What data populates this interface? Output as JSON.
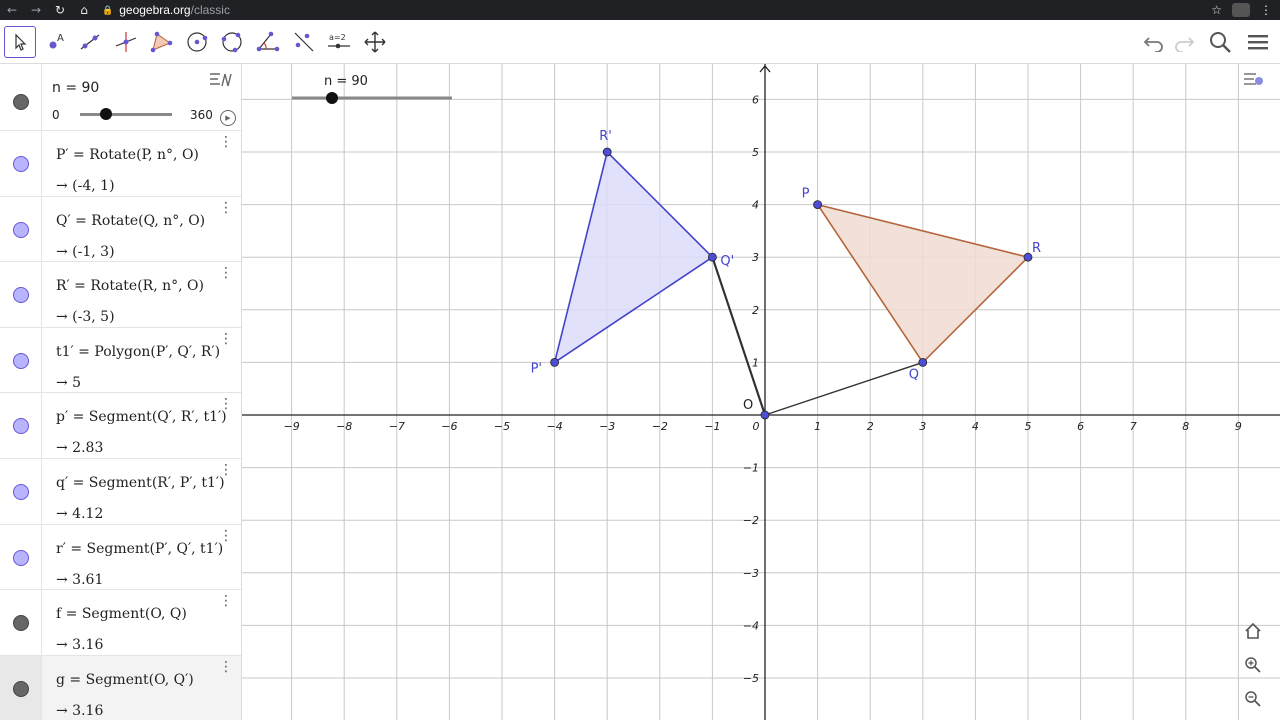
{
  "browser": {
    "back_icon": "arrow-left-icon",
    "forward_icon": "arrow-right-icon",
    "reload_icon": "reload-icon",
    "home_icon": "home-icon",
    "url_domain": "geogebra.org",
    "url_path": "/classic"
  },
  "toolbar": {
    "tools": [
      "move-tool",
      "point-tool",
      "line-tool",
      "perpendicular-line-tool",
      "polygon-tool",
      "circle-tool",
      "conic-tool",
      "angle-tool",
      "reflect-tool",
      "slider-tool",
      "move-graphics-tool"
    ],
    "slider_tool_label": "a=2",
    "right_icons": [
      "undo-icon",
      "redo-icon",
      "search-icon",
      "menu-icon"
    ]
  },
  "algebra": {
    "slider": {
      "name": "n = 90",
      "min": "0",
      "max": "360",
      "value": 90
    },
    "rows": [
      {
        "def": "P′ = Rotate(P, n°, O)",
        "val": "→  (-4, 1)",
        "color": "blue"
      },
      {
        "def": "Q′ = Rotate(Q, n°, O)",
        "val": "→  (-1, 3)",
        "color": "blue"
      },
      {
        "def": "R′ = Rotate(R, n°, O)",
        "val": "→  (-3, 5)",
        "color": "blue"
      },
      {
        "def": "t1′ = Polygon(P′, Q′, R′)",
        "val": "→  5",
        "color": "blue"
      },
      {
        "def": "p′ = Segment(Q′, R′, t1′)",
        "val": "→  2.83",
        "color": "blue"
      },
      {
        "def": "q′ = Segment(R′, P′, t1′)",
        "val": "→  4.12",
        "color": "blue"
      },
      {
        "def": "r′ = Segment(P′, Q′, t1′)",
        "val": "→  3.61",
        "color": "blue"
      },
      {
        "def": "f = Segment(O, Q)",
        "val": "→  3.16",
        "color": "dark"
      },
      {
        "def": "g = Segment(O, Q′)",
        "val": "→  3.16",
        "color": "dark"
      }
    ]
  },
  "graphics": {
    "slider_label": "n = 90",
    "x_ticks": [
      "−9",
      "−8",
      "−7",
      "−6",
      "−5",
      "−4",
      "−3",
      "−2",
      "−1",
      "0",
      "1",
      "2",
      "3",
      "4",
      "5",
      "6",
      "7",
      "8",
      "9"
    ],
    "y_ticks": [
      "6",
      "5",
      "4",
      "3",
      "2",
      "1",
      "−1",
      "−2",
      "−3",
      "−4",
      "−5"
    ],
    "points": [
      {
        "label": "P",
        "x": 1,
        "y": 4
      },
      {
        "label": "Q",
        "x": 3,
        "y": 1
      },
      {
        "label": "R",
        "x": 5,
        "y": 3
      },
      {
        "label": "P'",
        "x": -4,
        "y": 1
      },
      {
        "label": "Q'",
        "x": -1,
        "y": 3
      },
      {
        "label": "R'",
        "x": -3,
        "y": 5
      },
      {
        "label": "O",
        "x": 0,
        "y": 0
      }
    ],
    "colors": {
      "original": "#b5633a",
      "original_fill": "#f0dcd2",
      "image": "#4444cc",
      "image_fill": "#dcdcfa",
      "segment": "#333333",
      "point": "#4d4dd6"
    },
    "side_icons": [
      "home-icon",
      "zoom-in-icon",
      "zoom-out-icon"
    ]
  }
}
